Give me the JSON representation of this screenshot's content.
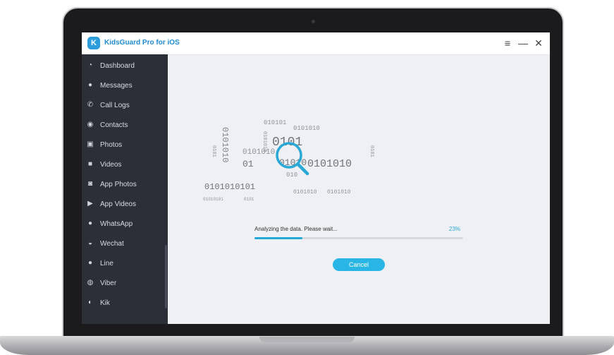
{
  "app": {
    "title": "KidsGuard Pro for iOS",
    "logo_icon": "kidsguard-logo-icon"
  },
  "window_controls": {
    "menu": "≡",
    "minimize": "—",
    "close": "✕"
  },
  "sidebar": {
    "items": [
      {
        "label": "Dashboard",
        "icon": "dashboard-icon"
      },
      {
        "label": "Messages",
        "icon": "message-icon"
      },
      {
        "label": "Call Logs",
        "icon": "phone-icon"
      },
      {
        "label": "Contacts",
        "icon": "contact-icon"
      },
      {
        "label": "Photos",
        "icon": "photo-icon"
      },
      {
        "label": "Videos",
        "icon": "video-icon"
      },
      {
        "label": "App Photos",
        "icon": "camera-icon"
      },
      {
        "label": "App Videos",
        "icon": "play-icon"
      },
      {
        "label": "WhatsApp",
        "icon": "whatsapp-icon"
      },
      {
        "label": "Wechat",
        "icon": "wechat-icon"
      },
      {
        "label": "Line",
        "icon": "line-icon"
      },
      {
        "label": "Viber",
        "icon": "viber-icon"
      },
      {
        "label": "Kik",
        "icon": "kik-icon"
      }
    ]
  },
  "analysis": {
    "status": "Analyzing the data. Please wait...",
    "percent_label": "23%",
    "progress": 0.23,
    "cancel_label": "Cancel",
    "graphic_icon": "magnifier-binary-icon",
    "binary": {
      "a": "010101",
      "b": "0101010",
      "c": "0101",
      "d": "0101010",
      "e": "01",
      "f": "01010",
      "g": "0101010",
      "h": "0101010101",
      "i": "010",
      "j": "0101010"
    }
  },
  "colors": {
    "accent": "#29b6e4",
    "sidebar": "#2b2f38",
    "content_bg": "#eef0f3"
  }
}
